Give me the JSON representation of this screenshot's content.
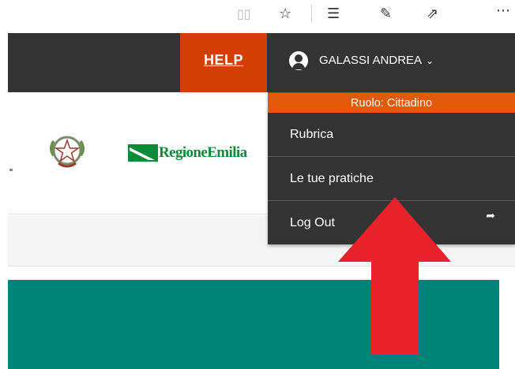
{
  "browser": {
    "icons": {
      "reading": "reading-view-icon",
      "star": "favorite-star-icon",
      "favorites": "favorites-list-icon",
      "pen": "web-note-icon",
      "share": "share-icon",
      "more": "more-icon"
    },
    "glyphs": {
      "reading": "▯▯",
      "star": "☆",
      "favorites": "☰",
      "pen": "✎",
      "share": "⇗",
      "more": "⋯"
    }
  },
  "header": {
    "help_label": "HELP",
    "user_name": "GALASSI ANDREA",
    "chevron": "⌄"
  },
  "logos": {
    "region_name": "RegioneEmilia"
  },
  "dropdown": {
    "role_label": "Ruolo: Cittadino",
    "items": [
      {
        "label": "Rubrica"
      },
      {
        "label": "Le tue pratiche"
      },
      {
        "label": "Log Out",
        "icon": "logout-icon",
        "glyph": "➦"
      }
    ]
  },
  "colors": {
    "header_bg": "#333333",
    "help_bg": "#d14000",
    "role_bg": "#e05a0a",
    "teal": "#00847a",
    "arrow": "#e8212a",
    "region_green": "#0b8a3a"
  }
}
